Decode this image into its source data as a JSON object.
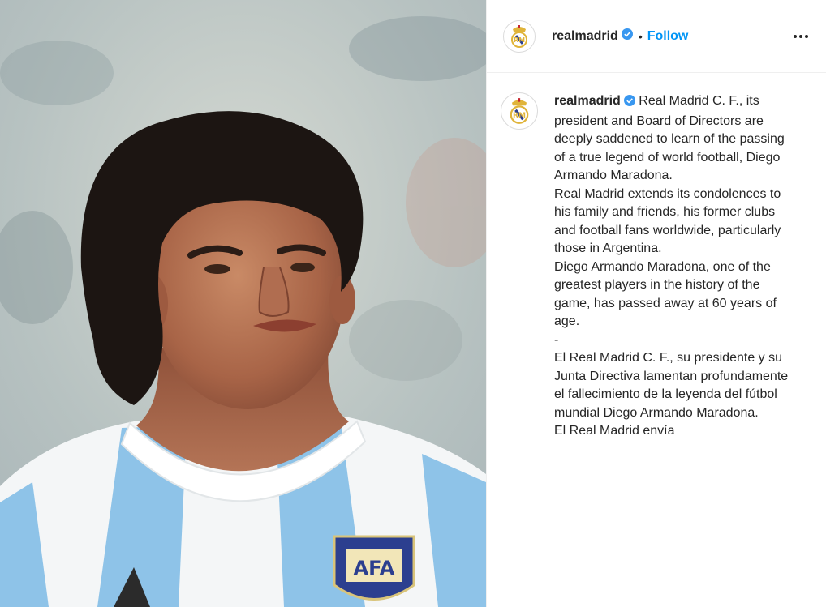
{
  "header": {
    "username": "realmadrid",
    "separator": "•",
    "follow_label": "Follow",
    "verified_icon": "verified-badge-icon",
    "more_icon": "more-options-icon"
  },
  "caption": {
    "username": "realmadrid",
    "text": " Real Madrid C. F., its president and Board of Directors are deeply saddened to learn of the passing of a true legend of world football, Diego Armando Maradona.\nReal Madrid extends its condolences to his family and friends, his former clubs and football fans worldwide, particularly those in Argentina.\nDiego Armando Maradona, one of the greatest players in the history of the game, has passed away at 60 years of age.\n-\nEl Real Madrid C. F., su presidente y su Junta Directiva lamentan profundamente el fallecimiento de la leyenda del fútbol mundial Diego Armando Maradona.\nEl Real Madrid envía"
  },
  "photo": {
    "badge_text": "AFA"
  },
  "colors": {
    "accent": "#0095f6",
    "verified": "#3897f0",
    "jersey_stripe": "#8ec3e8",
    "text": "#262626",
    "divider": "#efefef"
  }
}
